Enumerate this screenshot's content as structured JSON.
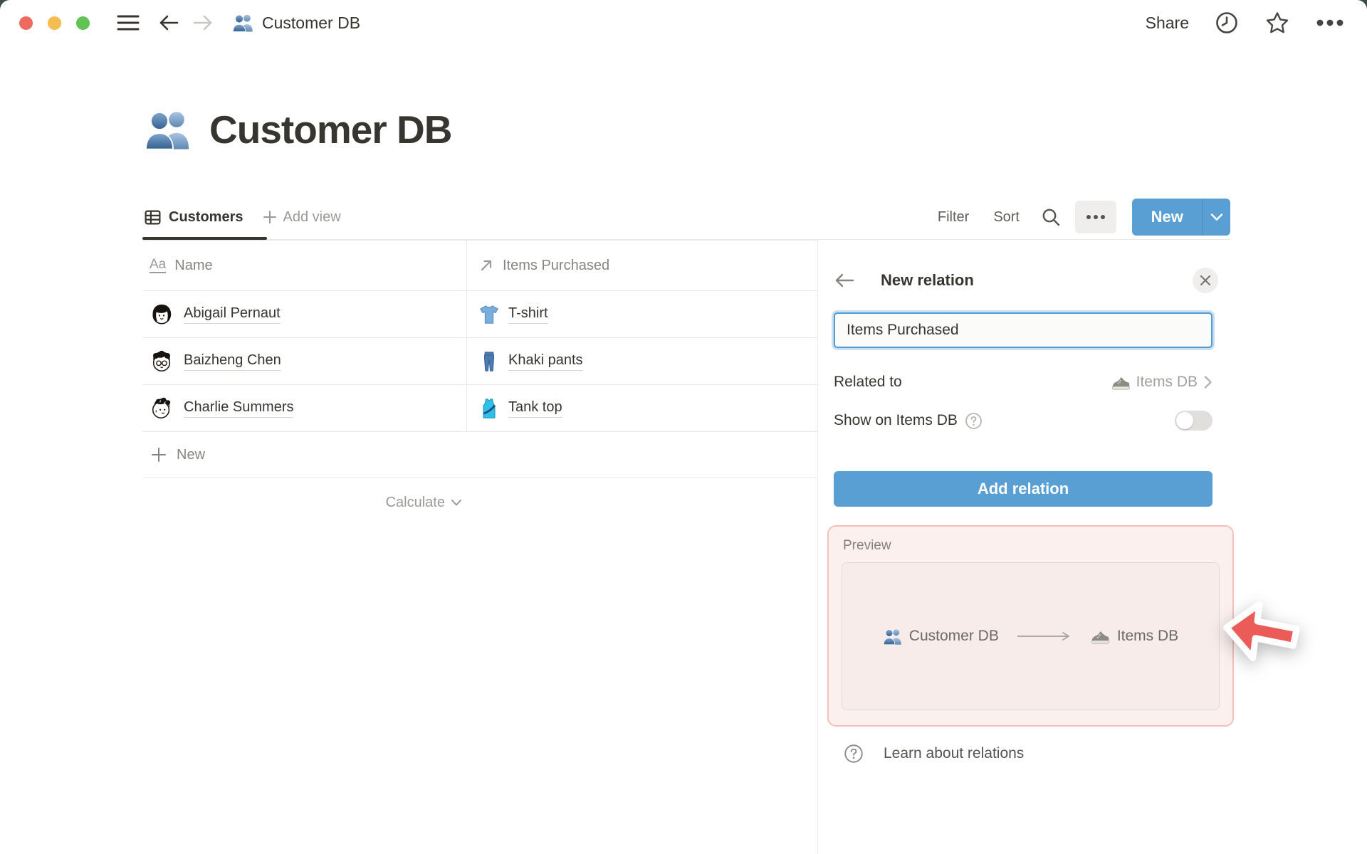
{
  "titlebar": {
    "title": "Customer DB",
    "share": "Share"
  },
  "page": {
    "icon": "people-icon",
    "title": "Customer DB"
  },
  "view_tabs": {
    "active": "Customers",
    "add_view": "Add view"
  },
  "toolbar": {
    "filter": "Filter",
    "sort": "Sort",
    "new": "New"
  },
  "table": {
    "columns": [
      {
        "label": "Name",
        "icon": "title-property-icon"
      },
      {
        "label": "Items Purchased",
        "icon": "relation-arrow-icon"
      }
    ],
    "rows": [
      {
        "name": "Abigail Pernaut",
        "avatar": "abigail-avatar",
        "item": "T-shirt",
        "item_icon": "tshirt-icon"
      },
      {
        "name": "Baizheng Chen",
        "avatar": "baizheng-avatar",
        "item": "Khaki pants",
        "item_icon": "pants-icon"
      },
      {
        "name": "Charlie Summers",
        "avatar": "charlie-avatar",
        "item": "Tank top",
        "item_icon": "tanktop-icon"
      }
    ],
    "new_row": "New",
    "calculate": "Calculate"
  },
  "panel": {
    "title": "New relation",
    "name_input_value": "Items Purchased",
    "related_to_label": "Related to",
    "related_to_value": "Items DB",
    "related_to_icon": "sneaker-icon",
    "show_on_label": "Show on Items DB",
    "toggle_state": "off",
    "add_button": "Add relation",
    "preview_label": "Preview",
    "preview_source": "Customer DB",
    "preview_source_icon": "people-icon",
    "preview_target": "Items DB",
    "preview_target_icon": "sneaker-icon",
    "learn": "Learn about relations"
  },
  "colors": {
    "accent_blue": "#5A9FD4",
    "text_dark": "#37352F",
    "text_gray": "#87857F",
    "border_gray": "#E9E9E7",
    "highlight_pink_border": "#F5C0BB",
    "highlight_pink_bg": "#FCF0EE",
    "annotation_arrow_red": "#EB5B57",
    "traffic_red": "#EE6A5F",
    "traffic_yellow": "#F5BD4F",
    "traffic_green": "#61C354"
  }
}
